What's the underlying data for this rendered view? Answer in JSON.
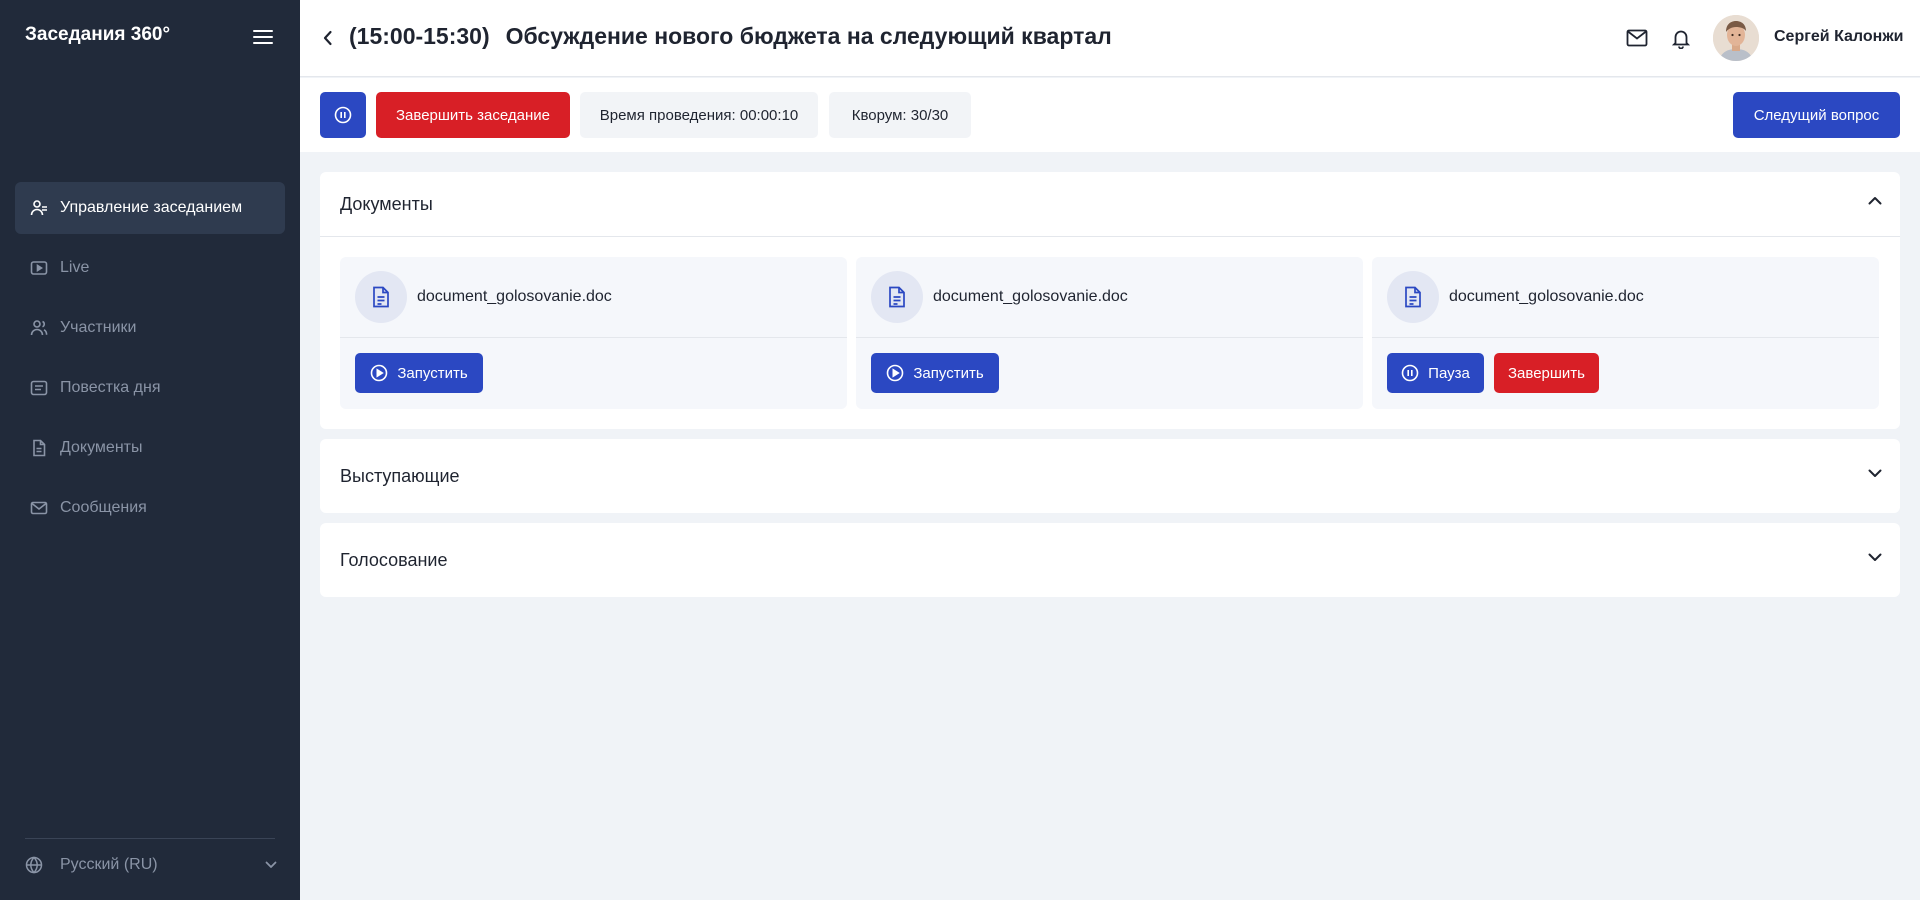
{
  "sidebar": {
    "brand": "Заседания 360°",
    "items": [
      {
        "label": "Управление заседанием",
        "icon": "user-manage-icon",
        "active": true
      },
      {
        "label": "Live",
        "icon": "live-video-icon",
        "active": false
      },
      {
        "label": "Участники",
        "icon": "participants-icon",
        "active": false
      },
      {
        "label": "Повестка дня",
        "icon": "agenda-icon",
        "active": false
      },
      {
        "label": "Документы",
        "icon": "document-icon",
        "active": false
      },
      {
        "label": "Сообщения",
        "icon": "mail-icon",
        "active": false
      }
    ],
    "language": "Русский (RU)"
  },
  "header": {
    "time": "(15:00-15:30)",
    "title": "Обсуждение нового бюджета на следующий квартал",
    "user_name": "Сергей Калонжи"
  },
  "toolbar": {
    "end_meeting": "Завершить заседание",
    "duration": "Время проведения: 00:00:10",
    "quorum": "Кворум: 30/30",
    "next_question": "Следущий вопрос"
  },
  "documents": {
    "title": "Документы",
    "expanded": true,
    "items": [
      {
        "name": "document_golosovanie.doc",
        "start_label": "Запустить"
      },
      {
        "name": "document_golosovanie.doc",
        "start_label": "Запустить"
      },
      {
        "name": "document_golosovanie.doc",
        "pause_label": "Пауза",
        "finish_label": "Завершить"
      }
    ]
  },
  "speakers": {
    "title": "Выступающие",
    "expanded": false
  },
  "voting": {
    "title": "Голосование",
    "expanded": false
  },
  "colors": {
    "sidebar_bg": "#212a3a",
    "primary": "#2b48c2",
    "danger": "#d81f26",
    "page_bg": "#f0f3f7"
  }
}
